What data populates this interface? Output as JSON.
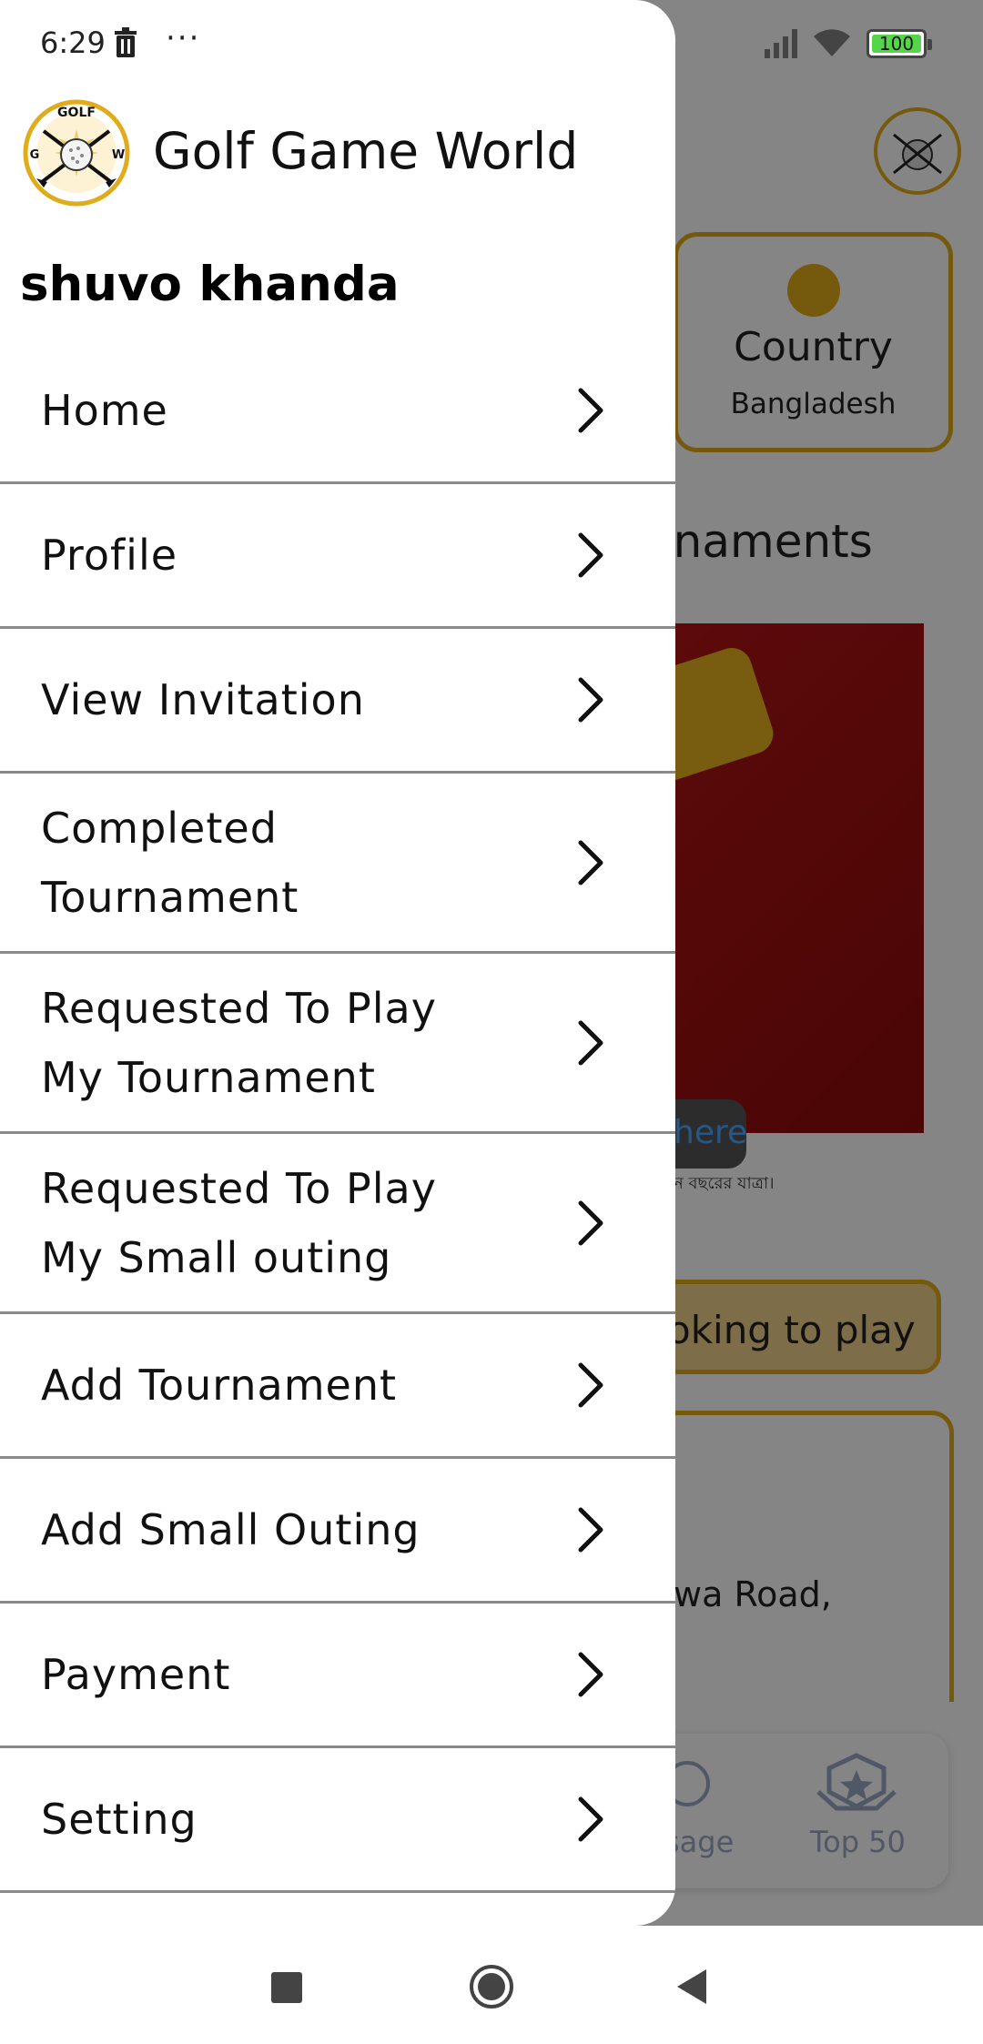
{
  "status_bar": {
    "time": "6:29",
    "overflow": "···",
    "battery": "100"
  },
  "drawer": {
    "app_title": "Golf Game World",
    "logo": {
      "top": "GOLF",
      "left": "G",
      "right": "W"
    },
    "user_name": "shuvo khanda",
    "menu": [
      {
        "lines": [
          "Home"
        ]
      },
      {
        "lines": [
          "Profile"
        ]
      },
      {
        "lines": [
          "View Invitation"
        ]
      },
      {
        "lines": [
          "Completed",
          "Tournament"
        ]
      },
      {
        "lines": [
          "Requested To Play",
          "My Tournament"
        ]
      },
      {
        "lines": [
          "Requested To Play",
          "My Small outing"
        ]
      },
      {
        "lines": [
          "Add Tournament"
        ]
      },
      {
        "lines": [
          "Add Small Outing"
        ]
      },
      {
        "lines": [
          "Payment"
        ]
      },
      {
        "lines": [
          "Setting"
        ]
      }
    ]
  },
  "background": {
    "country_title": "Country",
    "country_value": "Bangladesh",
    "tournaments_heading": "rnaments",
    "banner_button": "here",
    "banner_caption": "ন বছরের যাত্রা।",
    "looking_button": "oking to play",
    "venue_text": "wa Road,",
    "nav_message": "sage",
    "nav_top50": "Top 50"
  },
  "colors": {
    "accent": "#e0ac1b",
    "nav_inactive": "#9aa7c6",
    "battery": "#55d64a"
  }
}
